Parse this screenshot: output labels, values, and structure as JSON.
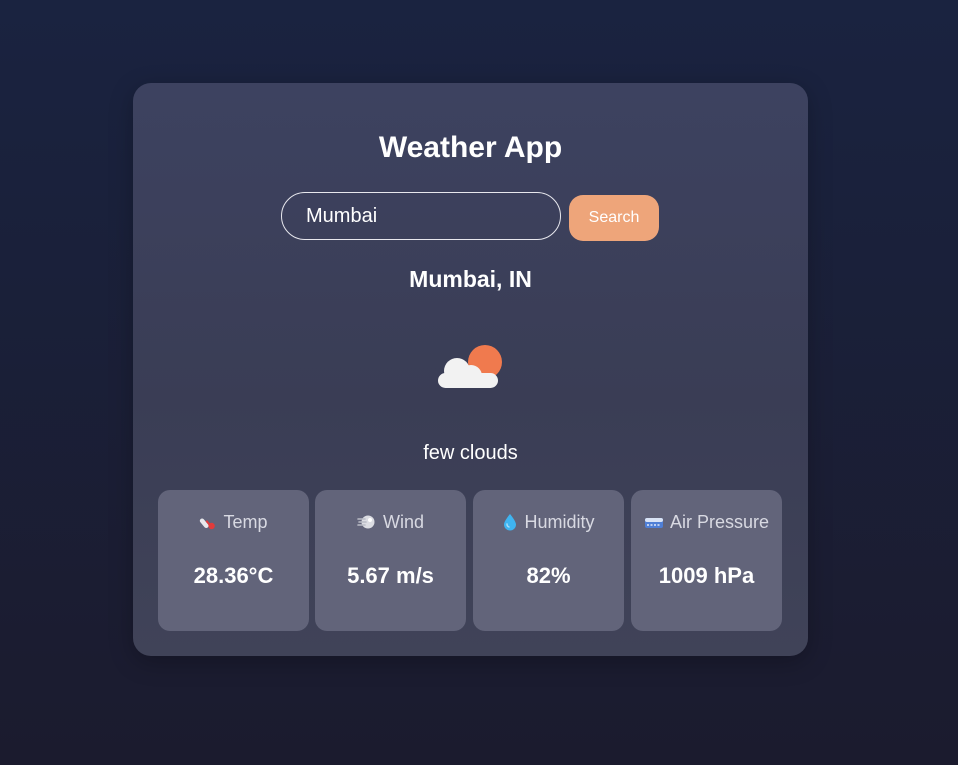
{
  "app": {
    "title": "Weather App"
  },
  "search": {
    "value": "Mumbai",
    "button_label": "Search"
  },
  "weather": {
    "location": "Mumbai, IN",
    "icon": "few-clouds-icon",
    "description": "few clouds"
  },
  "stats": [
    {
      "label": "Temp",
      "value": "28.36°C",
      "icon": "thermometer-icon"
    },
    {
      "label": "Wind",
      "value": "5.67 m/s",
      "icon": "wind-icon"
    },
    {
      "label": "Humidity",
      "value": "82%",
      "icon": "droplet-icon"
    },
    {
      "label": "Air Pressure",
      "value": "1009 hPa",
      "icon": "pressure-gauge-icon"
    }
  ],
  "colors": {
    "background": "#1a2340",
    "card": "#3d4260",
    "stat_card": "#62647a",
    "accent": "#eea57a",
    "sun": "#f07a4e"
  }
}
